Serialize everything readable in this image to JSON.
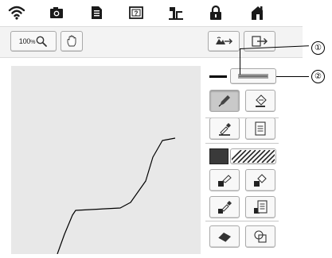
{
  "toolbar": {
    "icons": [
      "wifi-icon",
      "camera-icon",
      "document-icon",
      "help-icon",
      "sewing-machine-icon",
      "lock-icon",
      "home-icon"
    ]
  },
  "zoom": {
    "value": "100",
    "unit": "%"
  },
  "callouts": {
    "first": "①",
    "second": "②"
  }
}
